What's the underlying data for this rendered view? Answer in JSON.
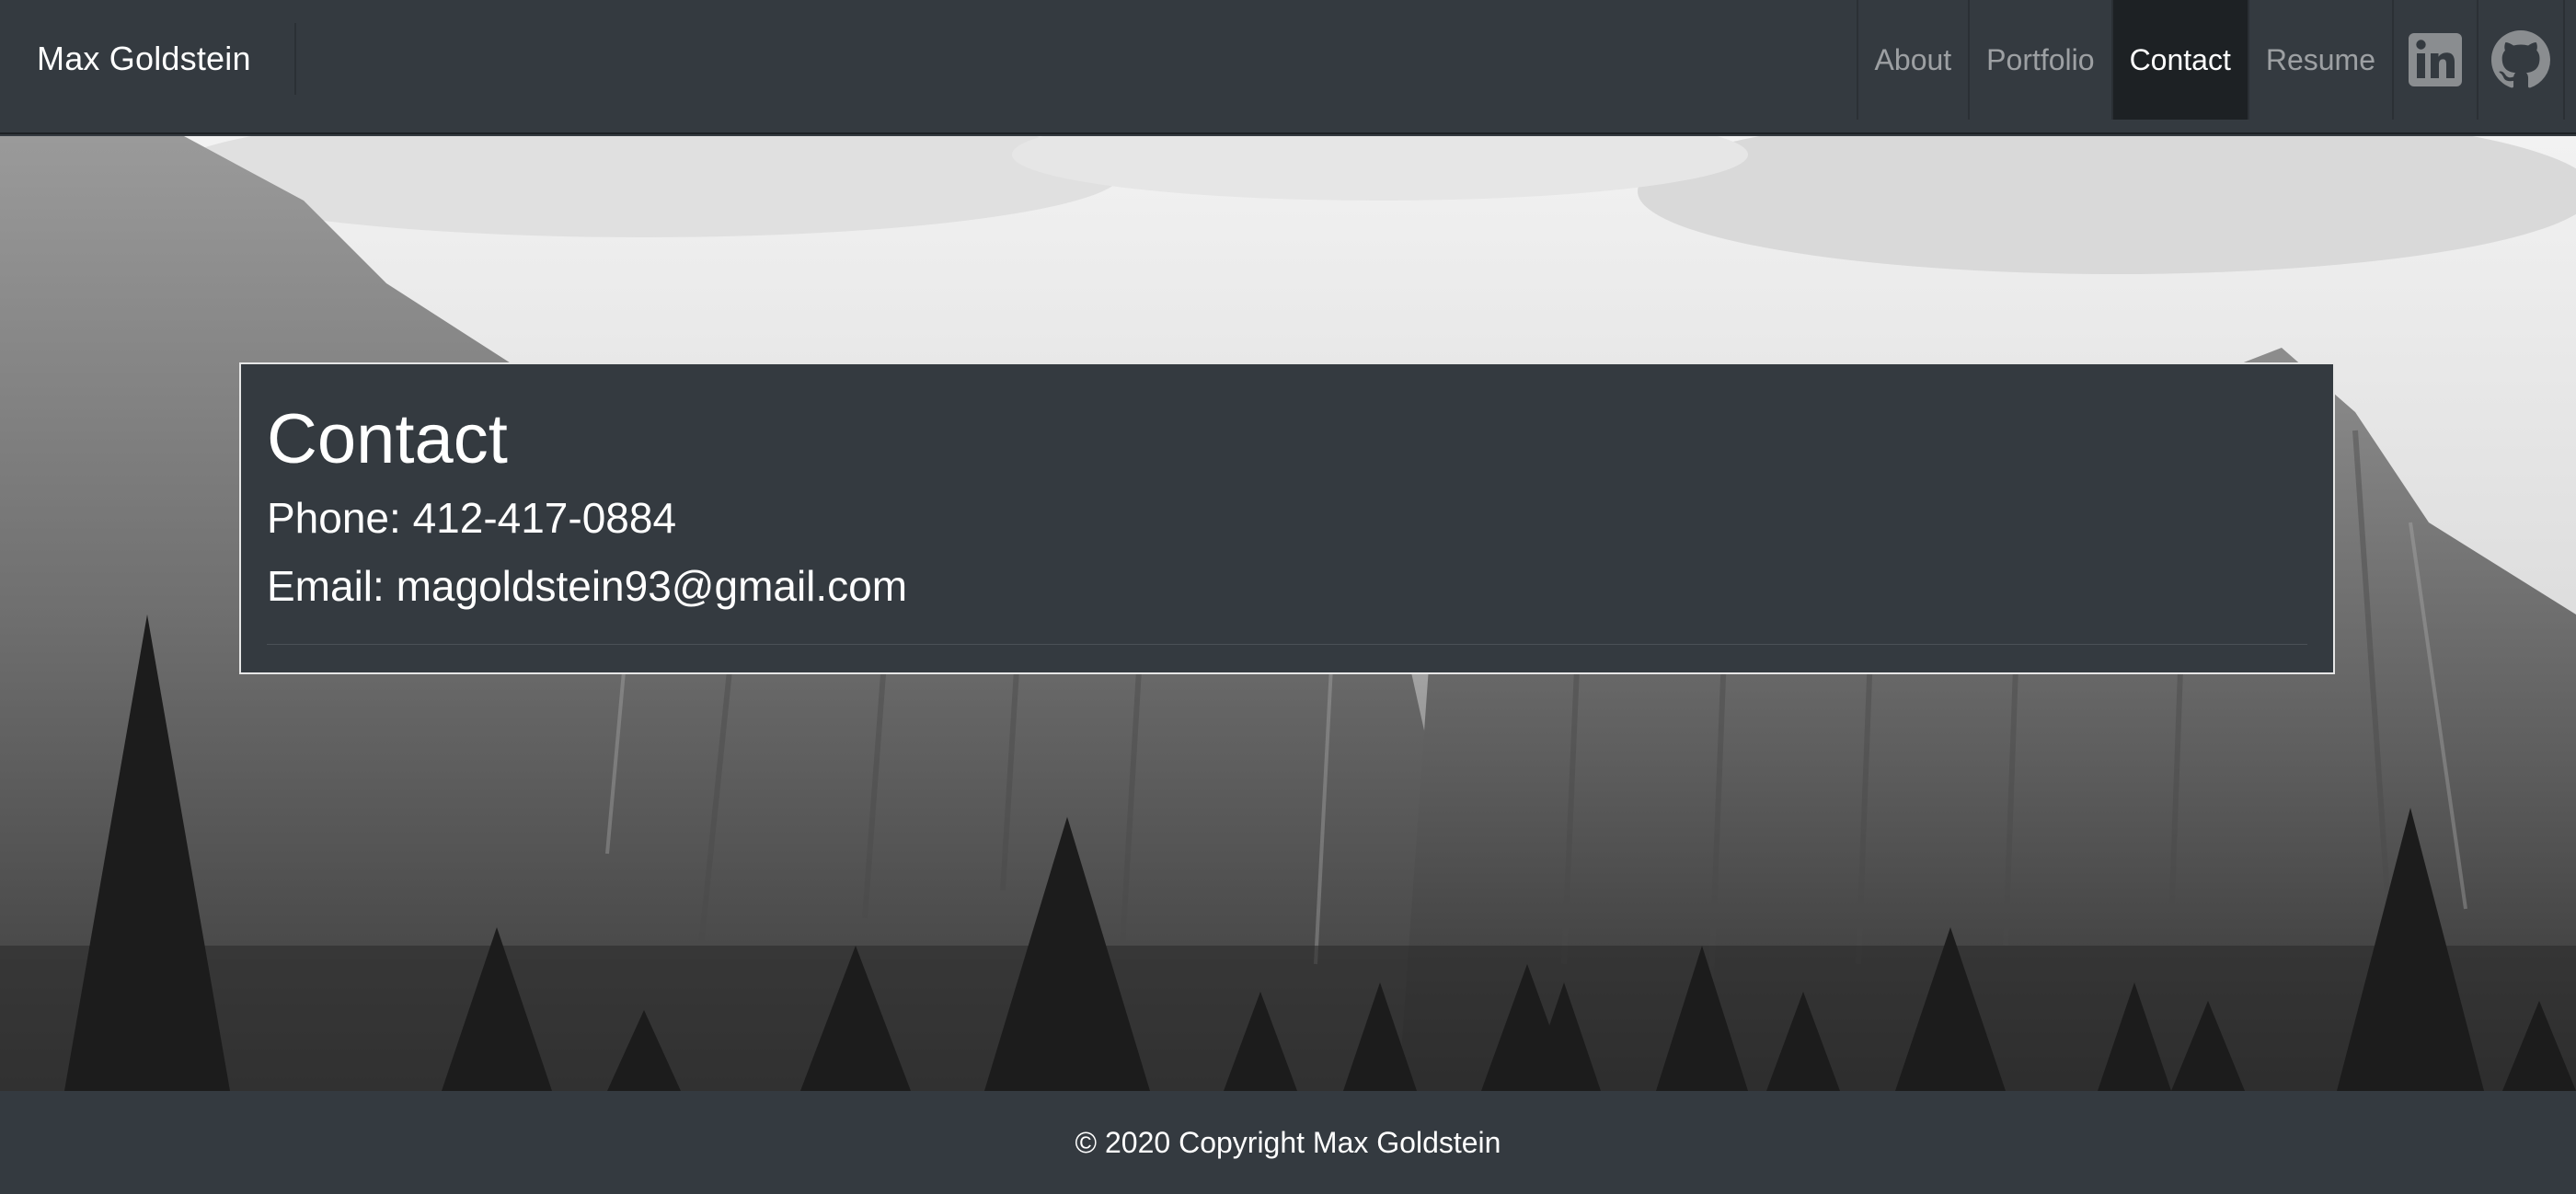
{
  "navbar": {
    "brand": "Max Goldstein",
    "items": [
      {
        "label": "About"
      },
      {
        "label": "Portfolio"
      },
      {
        "label": "Contact",
        "active": true
      },
      {
        "label": "Resume"
      }
    ],
    "icons": [
      "linkedin-icon",
      "github-icon"
    ]
  },
  "contact": {
    "title": "Contact",
    "phone": "Phone: 412-417-0884",
    "email": "Email: magoldstein93@gmail.com"
  },
  "footer": {
    "copyright": "© 2020 Copyright Max Goldstein"
  },
  "colors": {
    "navbar_bg": "#343a40",
    "active_tab_bg": "#1d2124",
    "text": "#ffffff",
    "nav_text_muted": "rgba(255,255,255,0.52)"
  }
}
